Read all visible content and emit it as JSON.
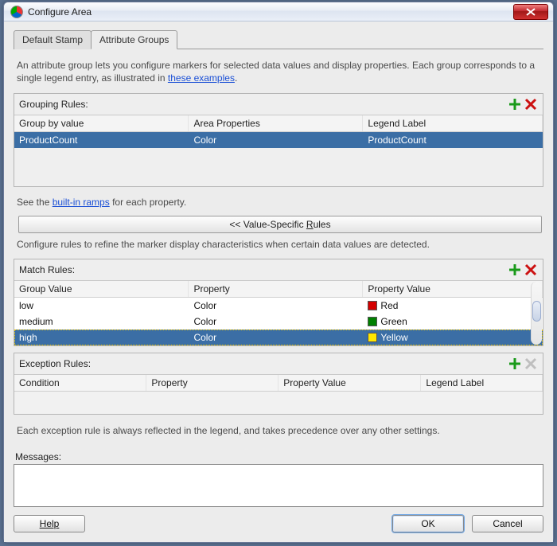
{
  "window": {
    "title": "Configure Area"
  },
  "tabs": {
    "default_stamp": "Default Stamp",
    "attribute_groups": "Attribute Groups"
  },
  "intro": {
    "text_a": "An attribute group lets you configure markers for selected data values and display properties. Each group corresponds to a single legend entry, as illustrated in ",
    "link": "these examples",
    "text_b": "."
  },
  "grouping": {
    "title": "Grouping Rules:",
    "headers": {
      "group_by": "Group by value",
      "area_props": "Area Properties",
      "legend": "Legend Label"
    },
    "rows": [
      {
        "group_by": "ProductCount",
        "area_props": "Color",
        "legend": "ProductCount"
      }
    ]
  },
  "ramps": {
    "pre": "See the ",
    "link": "built-in ramps",
    "post": " for each property."
  },
  "vsr_button": {
    "prefix": "<< Value-Specific ",
    "ul_char": "R",
    "suffix": "ules"
  },
  "vsr_desc": "Configure rules to refine the marker display characteristics when certain data values are detected.",
  "match": {
    "title": "Match Rules:",
    "headers": {
      "gval": "Group Value",
      "prop": "Property",
      "pval": "Property Value"
    },
    "rows": [
      {
        "gval": "low",
        "prop": "Color",
        "color": "#d40000",
        "pval": "Red"
      },
      {
        "gval": "medium",
        "prop": "Color",
        "color": "#008000",
        "pval": "Green"
      },
      {
        "gval": "high",
        "prop": "Color",
        "color": "#ffe600",
        "pval": "Yellow"
      }
    ]
  },
  "exception": {
    "title": "Exception Rules:",
    "headers": {
      "cond": "Condition",
      "prop": "Property",
      "pval": "Property Value",
      "legend": "Legend Label"
    }
  },
  "exc_desc": "Each exception rule is always reflected in the legend, and takes precedence over any other settings.",
  "messages_label": "Messages:",
  "footer": {
    "help": "Help",
    "ok": "OK",
    "cancel": "Cancel"
  }
}
